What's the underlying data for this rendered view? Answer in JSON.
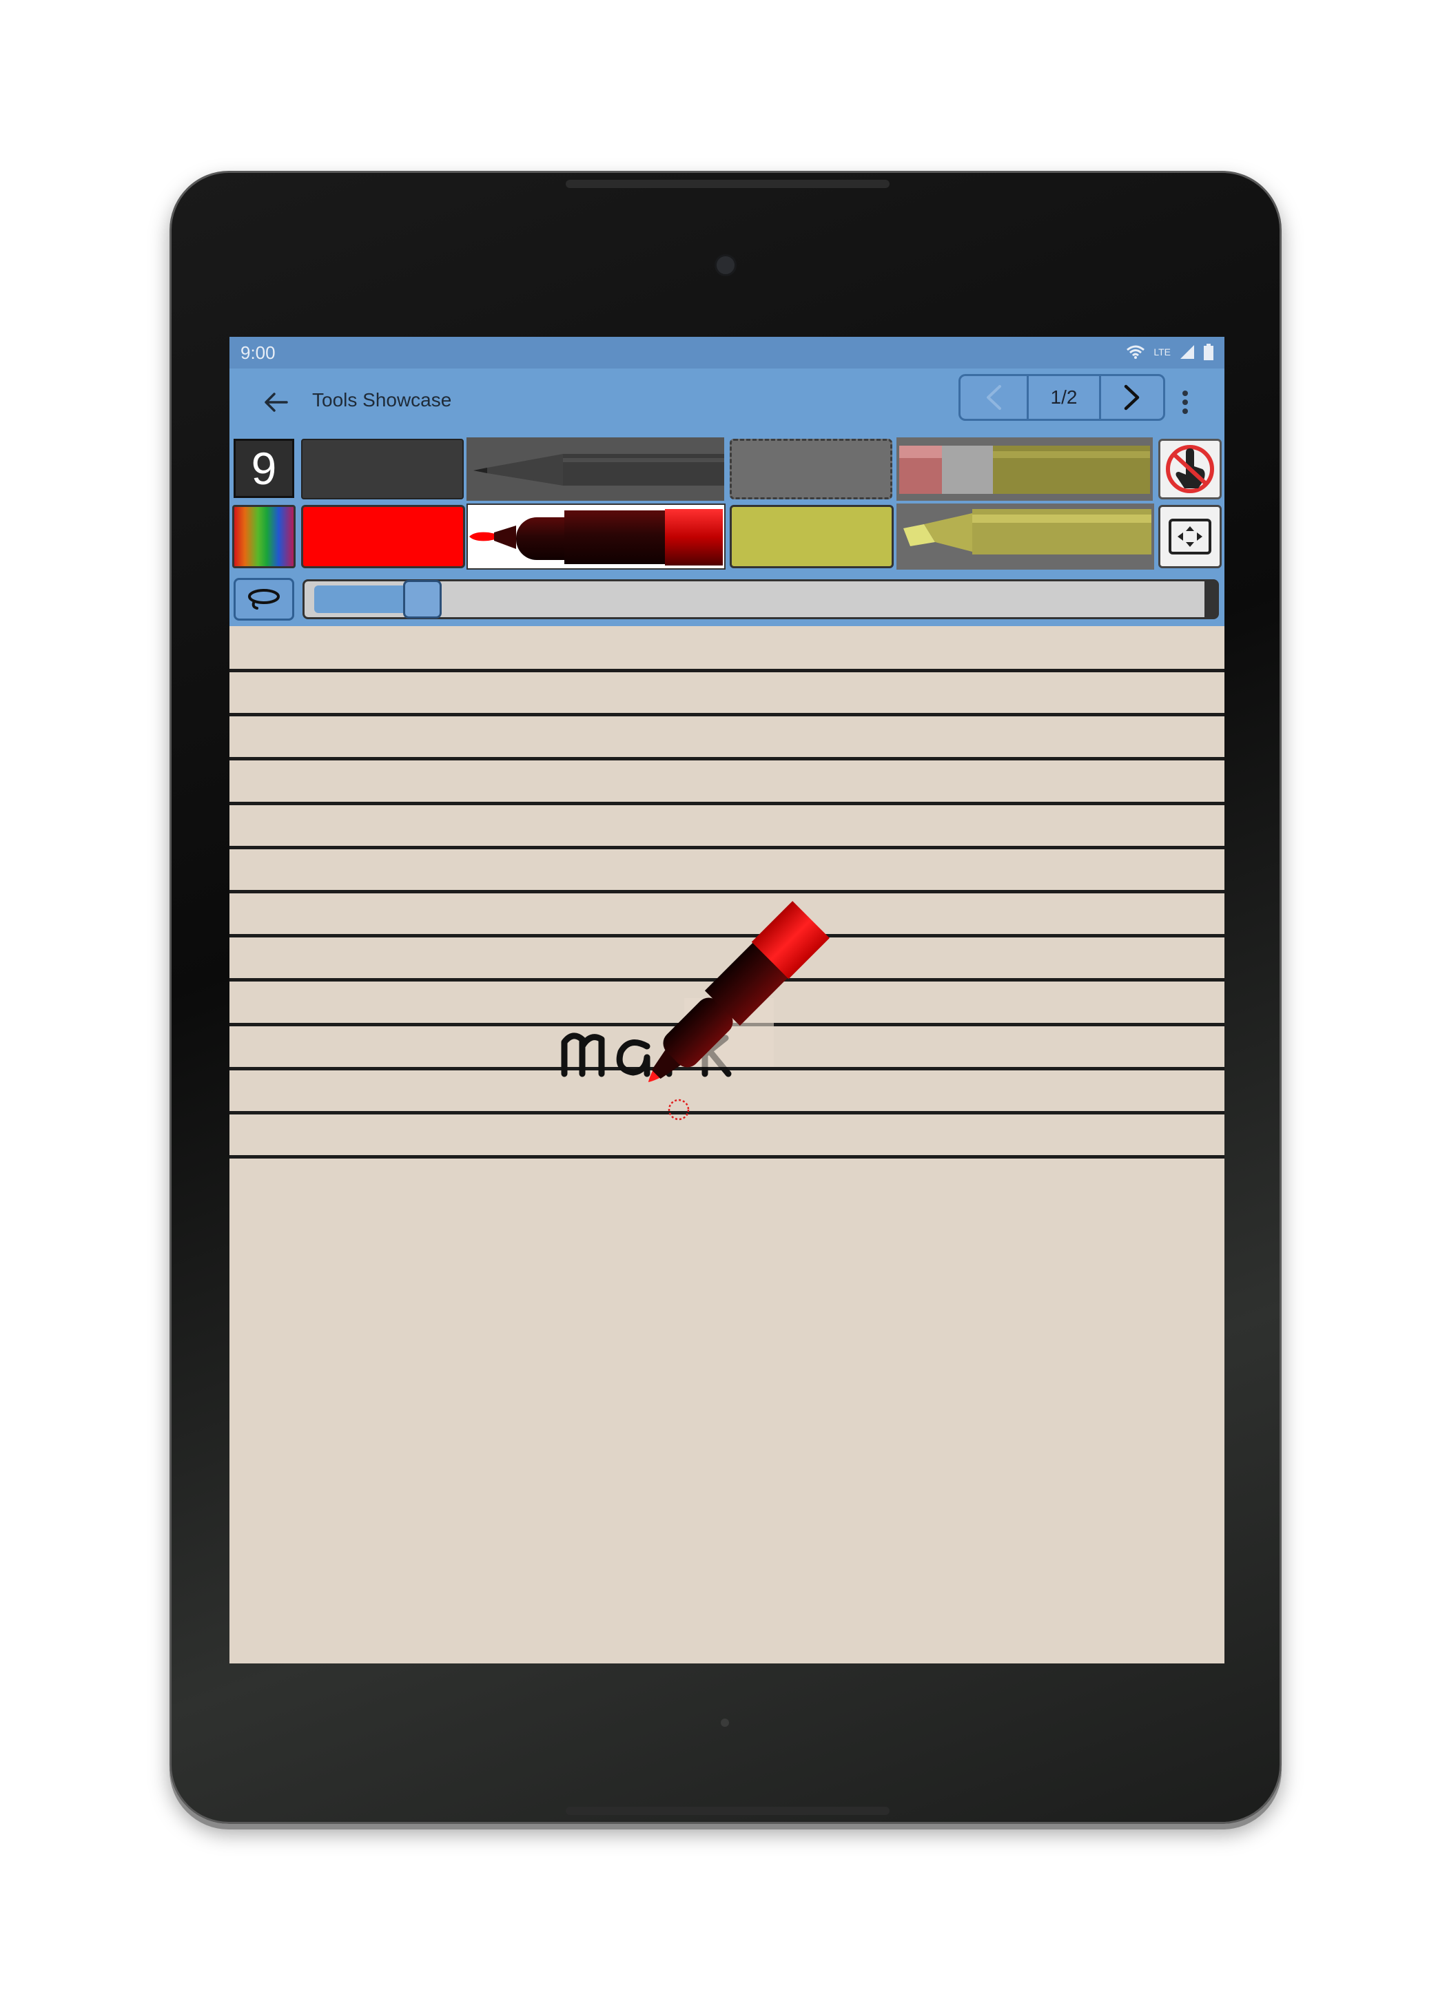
{
  "status_bar": {
    "time": "9:00",
    "network_label": "LTE"
  },
  "app_bar": {
    "title": "Tools Showcase",
    "page_indicator": "1/2"
  },
  "toolbar": {
    "tool_size": "9",
    "zoom_level": 0.1
  },
  "canvas": {
    "handwriting": "mark",
    "ruled_line_count": 12
  },
  "colors": {
    "bar_blue": "#6b9fd3",
    "status_blue": "#5f8fc4",
    "paper": "#e0d5c8",
    "ink_red": "#ff0000",
    "highlighter_olive": "#bfbf4b"
  }
}
